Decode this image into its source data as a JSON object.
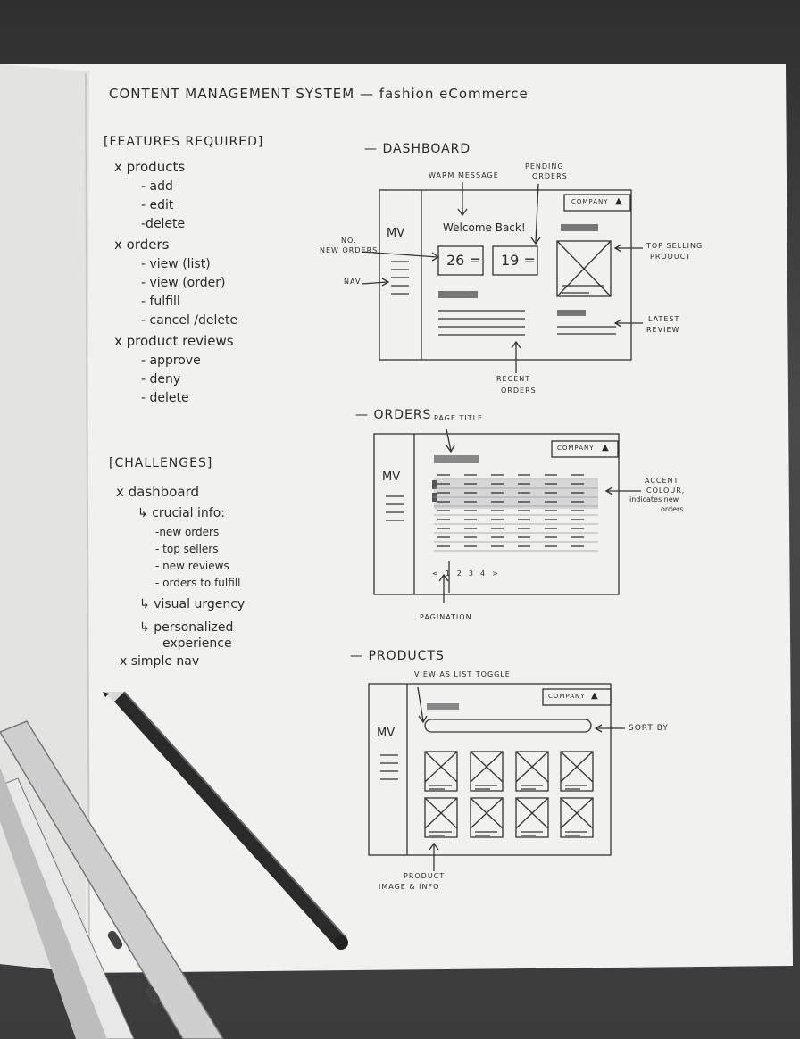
{
  "page_title": "CONTENT MANAGEMENT SYSTEM — fashion eCommerce",
  "features": {
    "heading": "[FEATURES REQUIRED]",
    "groups": [
      {
        "label": "x products",
        "items": [
          "- add",
          "- edit",
          "-delete"
        ]
      },
      {
        "label": "x orders",
        "items": [
          "- view (list)",
          "- view (order)",
          "- fulfill",
          "- cancel /delete"
        ]
      },
      {
        "label": "x product reviews",
        "items": [
          "- approve",
          "- deny",
          "- delete"
        ]
      }
    ]
  },
  "challenges": {
    "heading": "[CHALLENGES]",
    "dashboard_label": "x dashboard",
    "crucial_info": "crucial info:",
    "crucial_items": [
      "-new orders",
      "- top sellers",
      "- new reviews",
      "- orders to fulfill"
    ],
    "visual_urgency": "visual urgency",
    "personalized_1": "personalized",
    "personalized_2": "experience",
    "simple_nav": "x simple nav"
  },
  "dashboard": {
    "section_title": "— DASHBOARD",
    "logo": "MV",
    "company": "COMPANY",
    "welcome": "Welcome Back!",
    "new_orders_count": "26 =",
    "pending_count": "19 =",
    "annotations": {
      "warm_message": "WARM MESSAGE",
      "pending_orders_1": "PENDING",
      "pending_orders_2": "ORDERS",
      "new_orders_1": "NO.",
      "new_orders_2": "NEW ORDERS",
      "nav": "NAV",
      "top_selling_1": "TOP SELLING",
      "top_selling_2": "PRODUCT",
      "latest_review_1": "LATEST",
      "latest_review_2": "REVIEW",
      "recent_orders_1": "RECENT",
      "recent_orders_2": "ORDERS"
    }
  },
  "orders": {
    "section_title": "— ORDERS",
    "logo": "MV",
    "company": "COMPANY",
    "pagination": [
      "<",
      "1",
      "2",
      "3",
      "4",
      ">"
    ],
    "annotations": {
      "page_title": "PAGE TITLE",
      "accent_1": "ACCENT",
      "accent_2": "COLOUR,",
      "accent_3": "indicates new",
      "accent_4": "orders",
      "pagination": "PAGINATION"
    }
  },
  "products": {
    "section_title": "— PRODUCTS",
    "logo": "MV",
    "company": "COMPANY",
    "annotations": {
      "view_toggle": "VIEW AS LIST TOGGLE",
      "sort_by": "SORT BY",
      "product_info_1": "PRODUCT",
      "product_info_2": "IMAGE & INFO"
    }
  }
}
